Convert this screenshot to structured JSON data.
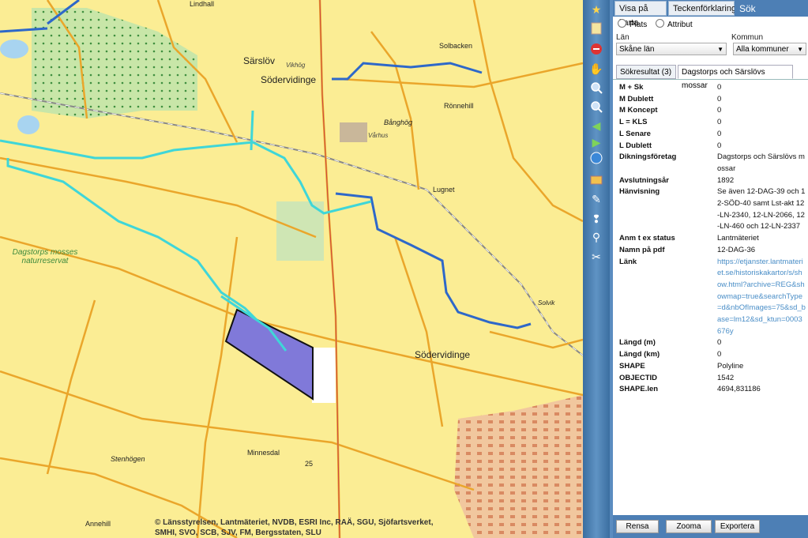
{
  "map": {
    "labels": {
      "sarslov": "Särslöv",
      "sodervidinge_n": "Södervidinge",
      "lindhall": "Lindhall",
      "vikhog": "Vikhög",
      "solbacken": "Solbacken",
      "ronnehill": "Rönnehill",
      "banghog": "Bånghög",
      "varhus": "Vårhus",
      "lugnet": "Lugnet",
      "dagstorp_reserve": "Dagstorps mosses naturreservat",
      "solvik": "Solvik",
      "sodervidinge_s": "Södervidinge",
      "stenhogen": "Stenhögen",
      "minnesdal": "Minnesdal",
      "annehill": "Annehill",
      "road_25": "25"
    },
    "copyright": "© Länsstyrelsen, Lantmäteriet, NVDB, ESRI Inc, RAÄ, SGU, Sjöfartsverket, SMHI, SVO, SCB, SJV, FM, Bergsstaten, SLU",
    "colors": {
      "background": "#fbed94",
      "roads": "#eaa62b",
      "ditch_blue": "#2e68c9",
      "ditch_cyan": "#3fd6d8",
      "polygon_fill": "#8079d9",
      "urban": "#e8a87a"
    }
  },
  "toolbar": {
    "icons": [
      "favorites-icon",
      "bookmark-icon",
      "clear-icon",
      "pan-icon",
      "zoom-in-icon",
      "zoom-out-icon",
      "back-icon",
      "forward-icon",
      "full-extent-icon",
      "layers-icon",
      "draw-icon",
      "identify-icon",
      "measure-icon",
      "tools-icon"
    ]
  },
  "panel": {
    "tabs": [
      "Visa på karta",
      "Teckenförklaring",
      "Sök"
    ],
    "search_mode": {
      "plats": "Plats",
      "attribut": "Attribut"
    },
    "lan": {
      "label": "Län",
      "value": "Skåne län"
    },
    "kommun": {
      "label": "Kommun",
      "value": "Alla kommuner"
    },
    "result_tabs": [
      "Sökresultat (3)",
      "Dagstorps och Särslövs mossar"
    ],
    "attributes": [
      {
        "key": "M + Sk",
        "value": "0"
      },
      {
        "key": "M Dublett",
        "value": "0"
      },
      {
        "key": "M Koncept",
        "value": "0"
      },
      {
        "key": "L = KLS",
        "value": "0"
      },
      {
        "key": "L Senare",
        "value": "0"
      },
      {
        "key": "L Dublett",
        "value": "0"
      },
      {
        "key": "Dikningsföretag",
        "value": "Dagstorps och Särslövs mossar"
      },
      {
        "key": "Avslutningsår",
        "value": "1892"
      },
      {
        "key": "Hänvisning",
        "value": "Se även 12-DAG-39 och 12-SÖD-40 samt Lst-akt 12-LN-2340, 12-LN-2066, 12-LN-460 och 12-LN-2337"
      },
      {
        "key": "Anm t ex status",
        "value": "Lantmäteriet"
      },
      {
        "key": "Namn på pdf",
        "value": "12-DAG-36"
      },
      {
        "key": "Länk",
        "value": "https://etjanster.lantmateriet.se/historiskakartor/s/show.html?archive=REG&showmap=true&searchType=d&nbOfImages=75&sd_base=lm12&sd_ktun=0003676y",
        "link": true
      },
      {
        "key": "Längd (m)",
        "value": "0"
      },
      {
        "key": "Längd (km)",
        "value": "0"
      },
      {
        "key": "SHAPE",
        "value": "Polyline"
      },
      {
        "key": "OBJECTID",
        "value": "1542"
      },
      {
        "key": "SHAPE.len",
        "value": "4694,831186"
      }
    ],
    "buttons": {
      "reset": "Rensa",
      "zoom": "Zooma",
      "export": "Exportera"
    }
  }
}
